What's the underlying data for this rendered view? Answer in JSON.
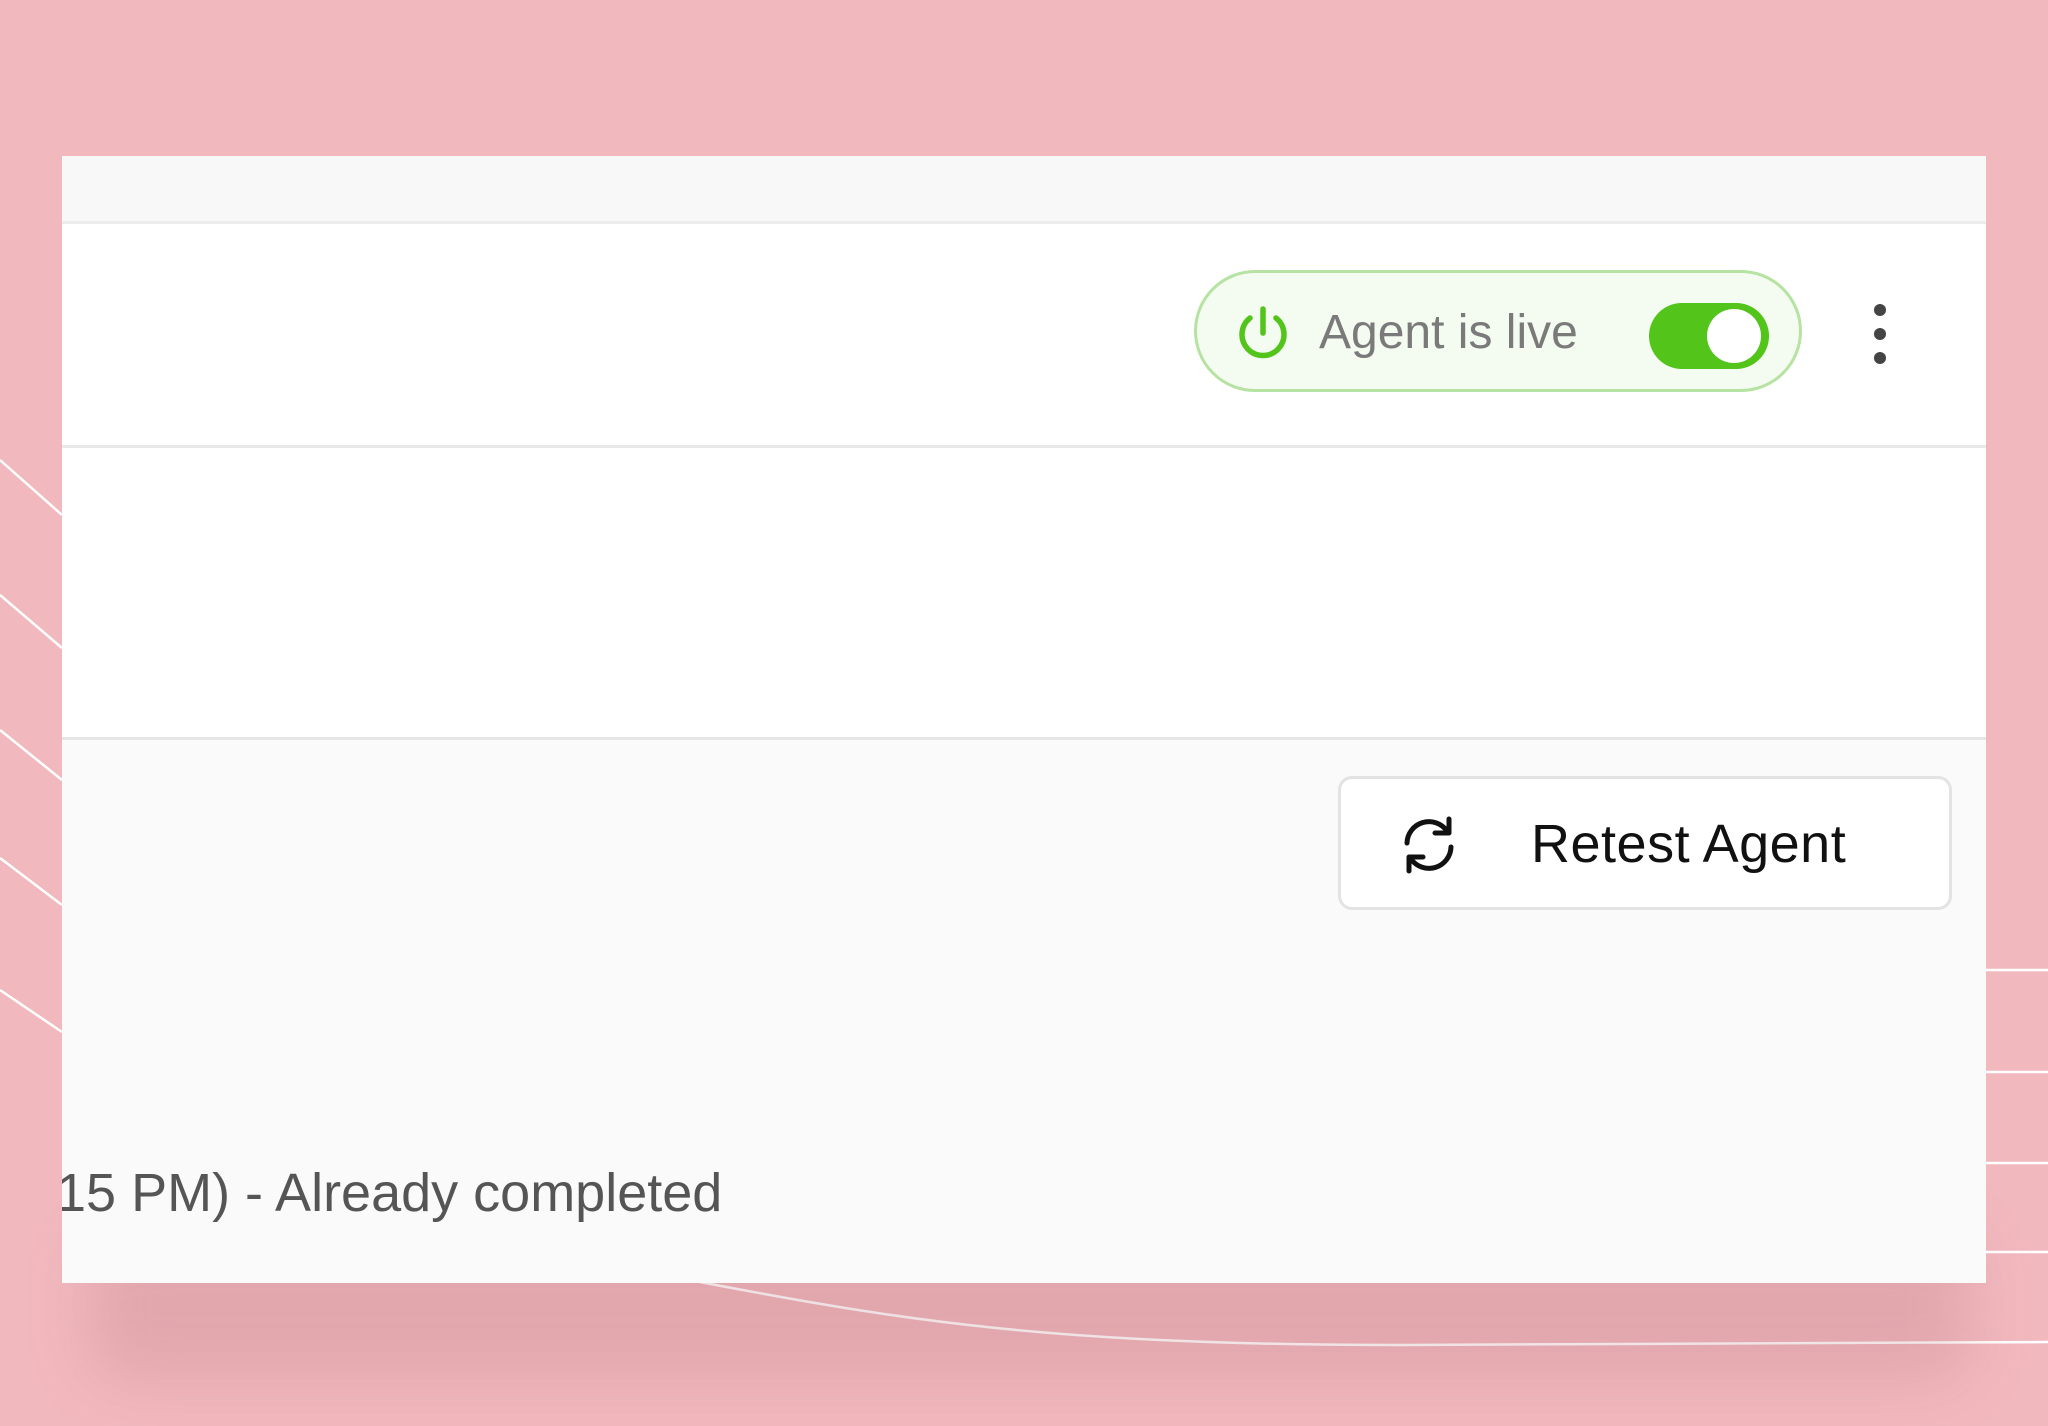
{
  "colors": {
    "background": "#f1b8be",
    "accent_green": "#52c41a",
    "pill_border": "#b6e3a2"
  },
  "header": {
    "agent_status": {
      "label": "Agent is live",
      "toggle_on": true,
      "icon": "power-icon"
    },
    "more_menu_icon": "more-vertical-icon"
  },
  "actions": {
    "retest_label": "Retest Agent",
    "retest_icon": "refresh-icon"
  },
  "task_list": {
    "status_text": "15 PM) - Already completed"
  }
}
